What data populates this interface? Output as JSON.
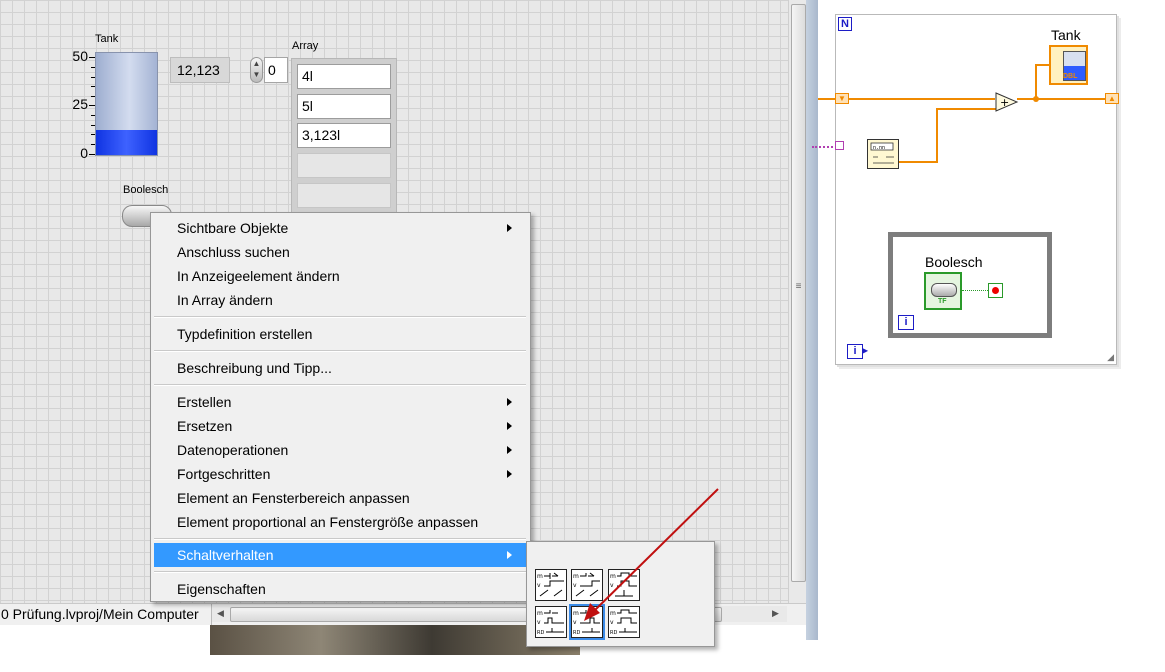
{
  "front_panel": {
    "tank": {
      "label": "Tank",
      "scale": [
        "50",
        "25",
        "0"
      ],
      "fill_fraction": 0.25,
      "value_display": "12,123"
    },
    "array": {
      "label": "Array",
      "index": "0",
      "cells": [
        "4l",
        "5l",
        "3,123l",
        "",
        ""
      ]
    },
    "boolean": {
      "label": "Boolesch"
    },
    "status_bar": {
      "project_path": "0 Prüfung.lvproj/Mein Computer"
    }
  },
  "context_menu": {
    "items": [
      {
        "label": "Sichtbare Objekte",
        "submenu": true
      },
      {
        "label": "Anschluss suchen",
        "submenu": false
      },
      {
        "label": "In Anzeigeelement ändern",
        "submenu": false
      },
      {
        "label": "In Array ändern",
        "submenu": false
      },
      {
        "label": "Typdefinition erstellen",
        "submenu": false
      },
      {
        "label": "Beschreibung und Tipp...",
        "submenu": false
      },
      {
        "label": "Erstellen",
        "submenu": true
      },
      {
        "label": "Ersetzen",
        "submenu": true
      },
      {
        "label": "Datenoperationen",
        "submenu": true
      },
      {
        "label": "Fortgeschritten",
        "submenu": true
      },
      {
        "label": "Element an Fensterbereich anpassen",
        "submenu": false
      },
      {
        "label": "Element proportional an Fenstergröße anpassen",
        "submenu": false
      },
      {
        "label": "Schaltverhalten",
        "submenu": true,
        "highlighted": true
      },
      {
        "label": "Eigenschaften",
        "submenu": false
      }
    ],
    "highlight_color": "#3399ff"
  },
  "mechanical_action_submenu": {
    "options": [
      {
        "id": "switch-when-pressed",
        "selected": false
      },
      {
        "id": "switch-when-released",
        "selected": false
      },
      {
        "id": "switch-until-released",
        "selected": false
      },
      {
        "id": "latch-when-pressed",
        "selected": false
      },
      {
        "id": "latch-when-released",
        "selected": true
      },
      {
        "id": "latch-until-released",
        "selected": false
      }
    ]
  },
  "block_diagram": {
    "for_loop_count_label": "N",
    "for_loop_index_label": "i",
    "while_loop_index_label": "i",
    "tank_terminal_label": "Tank",
    "tank_terminal_type": "DBL",
    "boolean_terminal_label": "Boolesch",
    "boolean_terminal_type": "TF",
    "wire_color": "#f08a00",
    "add_symbol": "+"
  },
  "annotation": {
    "arrow_color": "#c01010"
  }
}
